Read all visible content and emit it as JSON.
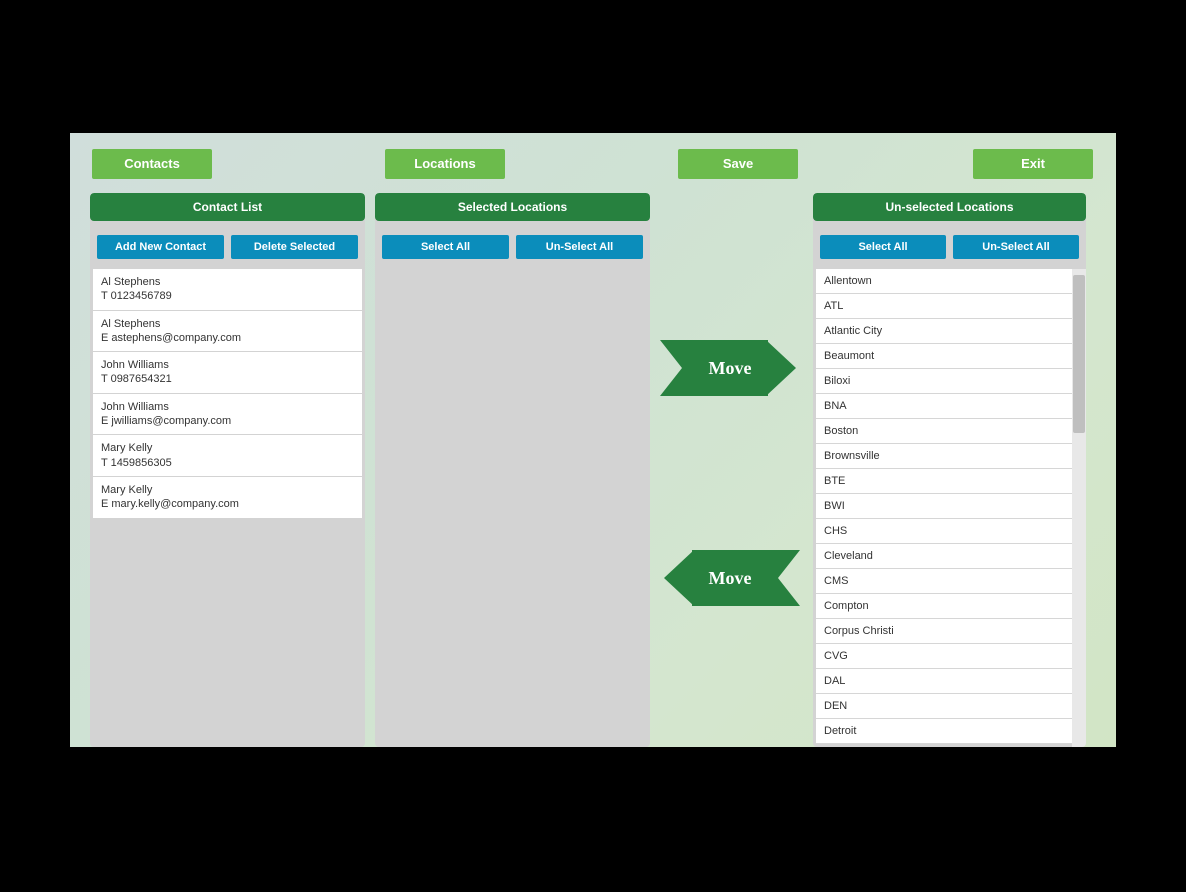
{
  "topbar": {
    "contacts": "Contacts",
    "locations": "Locations",
    "save": "Save",
    "exit": "Exit"
  },
  "contacts_panel": {
    "header": "Contact List",
    "add_btn": "Add New Contact",
    "delete_btn": "Delete Selected",
    "contacts": [
      {
        "name": "Al Stephens",
        "line2": "T 0123456789"
      },
      {
        "name": "Al Stephens",
        "line2": "E astephens@company.com"
      },
      {
        "name": "John Williams",
        "line2": "T 0987654321"
      },
      {
        "name": "John Williams",
        "line2": "E jwilliams@company.com"
      },
      {
        "name": "Mary Kelly",
        "line2": "T 1459856305"
      },
      {
        "name": "Mary Kelly",
        "line2": "E mary.kelly@company.com"
      }
    ]
  },
  "selected_panel": {
    "header": "Selected Locations",
    "select_all": "Select All",
    "unselect_all": "Un-Select All",
    "items": []
  },
  "move": {
    "right": "Move",
    "left": "Move"
  },
  "unselected_panel": {
    "header": "Un-selected Locations",
    "select_all": "Select All",
    "unselect_all": "Un-Select All",
    "items": [
      "Allentown",
      "ATL",
      "Atlantic City",
      "Beaumont",
      "Biloxi",
      "BNA",
      "Boston",
      "Brownsville",
      "BTE",
      "BWI",
      "CHS",
      "Cleveland",
      "CMS",
      "Compton",
      "Corpus Christi",
      "CVG",
      "DAL",
      "DEN",
      "Detroit"
    ]
  }
}
